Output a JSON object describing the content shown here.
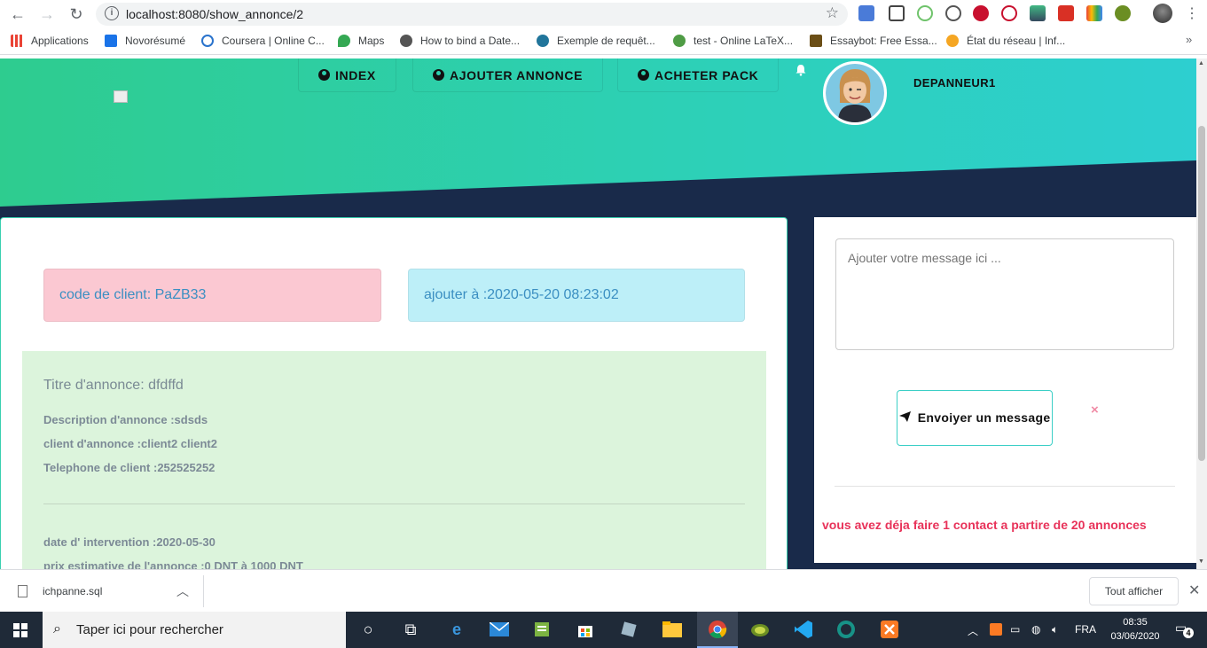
{
  "browser": {
    "url": "localhost:8080/show_annonce/2",
    "bookmarks": [
      {
        "label": "Applications",
        "icon": "apps-grid-icon",
        "color": "#4285f4"
      },
      {
        "label": "Novorésumé",
        "icon": "novoresume-icon",
        "color": "#1a73e8"
      },
      {
        "label": "Coursera | Online C...",
        "icon": "coursera-icon",
        "color": "#2a73cc"
      },
      {
        "label": "Maps",
        "icon": "maps-icon",
        "color": "#34a853"
      },
      {
        "label": "How to bind a Date...",
        "icon": "globe-icon",
        "color": "#555555"
      },
      {
        "label": "Exemple de requêt...",
        "icon": "wordpress-icon",
        "color": "#21759b"
      },
      {
        "label": "test - Online LaTeX...",
        "icon": "overleaf-icon",
        "color": "#4f9c45"
      },
      {
        "label": "Essaybot: Free Essa...",
        "icon": "essaybot-icon",
        "color": "#6b4e16"
      },
      {
        "label": "État du réseau | Inf...",
        "icon": "search-orange-icon",
        "color": "#f5a623"
      }
    ]
  },
  "header": {
    "nav": [
      {
        "label": "INDEX"
      },
      {
        "label": "AJOUTER ANNONCE"
      },
      {
        "label": "ACHETER PACK"
      }
    ],
    "username": "DEPANNEUR1"
  },
  "annonce": {
    "client_code": "code de client: PaZB33",
    "added_at": "ajouter à :2020-05-20 08:23:02",
    "title": "Titre d'annonce: dfdffd",
    "description": "Description d'annonce :sdsds",
    "client": "client d'annonce :client2 client2",
    "phone": "Telephone de client :252525252",
    "intervention_date": "date d' intervention :2020-05-30",
    "price": "prix estimative de l'annonce :0 DNT à 1000 DNT"
  },
  "message": {
    "placeholder": "Ajouter votre message ici ...",
    "send_label": "Envoiyer un message",
    "close_symbol": "×",
    "contact_info": "vous avez déja faire 1 contact a partire de 20 annonces"
  },
  "downloads": {
    "file": "ichpanne.sql",
    "show_all": "Tout afficher"
  },
  "taskbar": {
    "search_placeholder": "Taper ici pour rechercher",
    "lang": "FRA",
    "time": "08:35",
    "date": "03/06/2020",
    "notifications": "4"
  },
  "colors": {
    "hero_start": "#2ecc8f",
    "hero_end": "#2dcfd0",
    "dark_band": "#192a4a",
    "pink_badge": "#fbc8d2",
    "cyan_badge": "#bdeff8",
    "details_bg": "#dcf4dc",
    "alert_text": "#e8335a"
  }
}
